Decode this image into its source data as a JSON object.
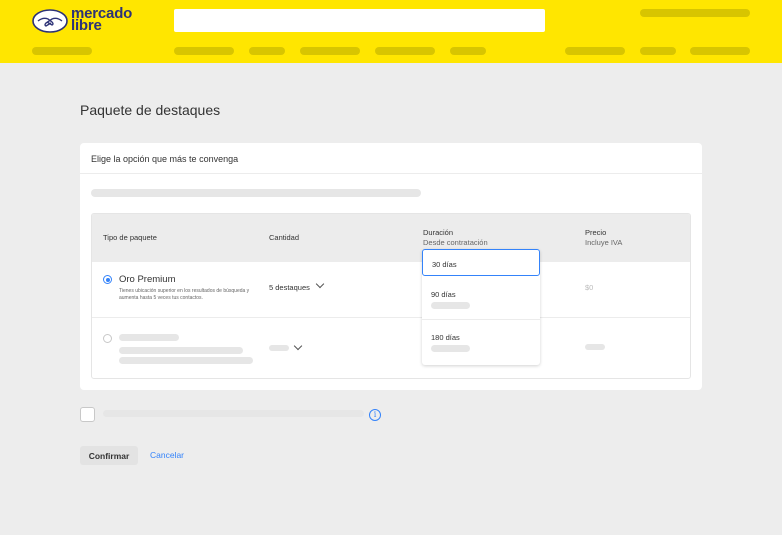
{
  "header": {
    "logo_text_line1": "mercado",
    "logo_text_line2": "libre",
    "brand_color": "#ffe600",
    "search": {
      "value": "",
      "placeholder": ""
    }
  },
  "page": {
    "title": "Paquete de destaques"
  },
  "card": {
    "title": "Elige la opción que más te convenga",
    "table": {
      "columns": [
        {
          "label": "Tipo de paquete",
          "sub": ""
        },
        {
          "label": "Cantidad",
          "sub": ""
        },
        {
          "label": "Duración",
          "sub": "Desde contratación"
        },
        {
          "label": "Precio",
          "sub": "Incluye IVA"
        }
      ],
      "rows": [
        {
          "selected": true,
          "name": "Oro Premium",
          "description": "Tienes ubicación superior en los resultados de búsqueda y aumenta hasta 5 veces tus contactos.",
          "quantity": "5 destaques",
          "price": "$0"
        }
      ]
    }
  },
  "duration_dropdown": {
    "options": [
      {
        "label": "30 días",
        "selected": true
      },
      {
        "label": "90 días",
        "selected": false
      },
      {
        "label": "180 días",
        "selected": false
      }
    ]
  },
  "footer": {
    "info_icon_glyph": "i",
    "confirm_label": "Confirmar",
    "cancel_label": "Cancelar"
  },
  "colors": {
    "accent": "#3483fa",
    "header": "#ffe600",
    "logo_text": "#2d3277"
  }
}
